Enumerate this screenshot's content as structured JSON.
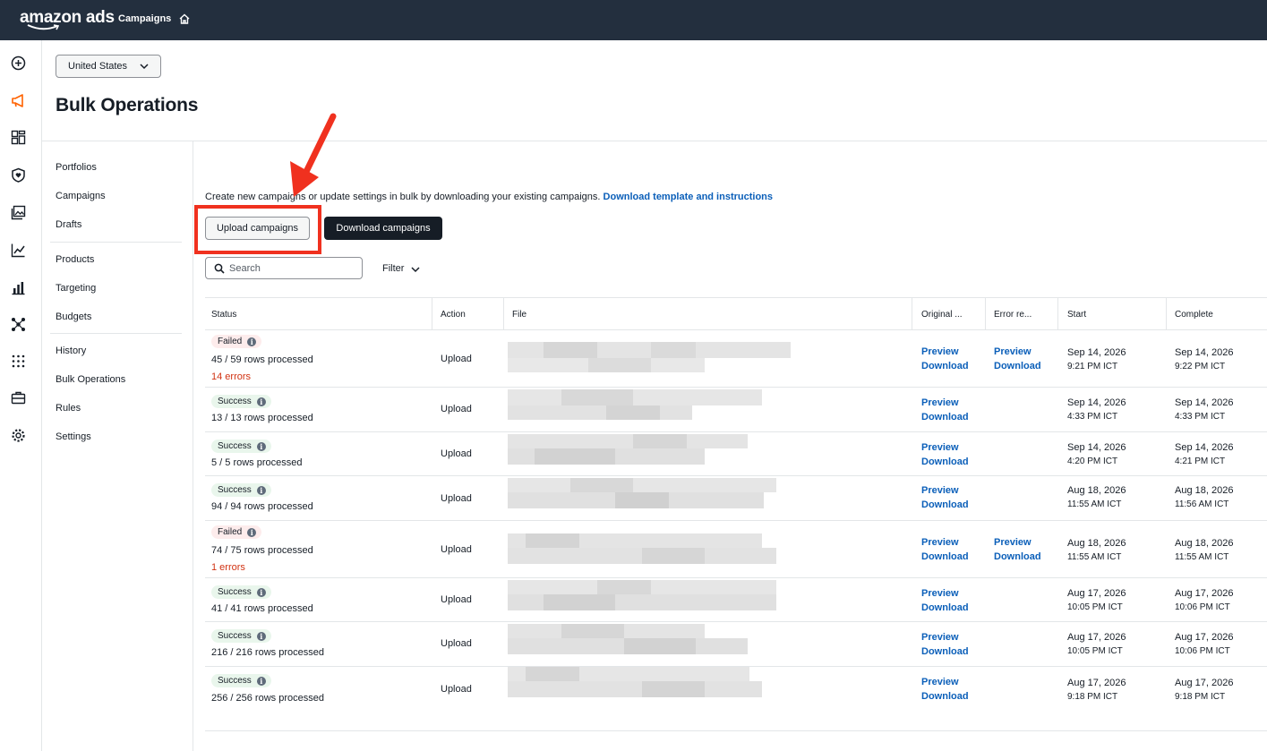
{
  "topbar": {
    "logo": "amazon ads",
    "nav_campaigns": "Campaigns"
  },
  "country_select": {
    "value": "United States"
  },
  "page_title": "Bulk Operations",
  "subnav": {
    "group1": [
      "Portfolios",
      "Campaigns",
      "Drafts"
    ],
    "group2": [
      "Products",
      "Targeting",
      "Budgets"
    ],
    "group3": [
      "History",
      "Bulk Operations",
      "Rules",
      "Settings"
    ]
  },
  "intro": {
    "text": "Create new campaigns or update settings in bulk by downloading your existing campaigns.",
    "link": "Download template and instructions"
  },
  "buttons": {
    "upload": "Upload campaigns",
    "download": "Download campaigns"
  },
  "search": {
    "placeholder": "Search"
  },
  "filter": {
    "label": "Filter"
  },
  "table": {
    "headers": [
      "Status",
      "Action",
      "File",
      "Original ...",
      "Error re...",
      "Start",
      "Complete"
    ],
    "rows": [
      {
        "status": "Failed",
        "rows": "45 / 59 rows processed",
        "errors": "14 errors",
        "action": "Upload",
        "orig_preview": "Preview",
        "orig_download": "Download",
        "err_preview": "Preview",
        "err_download": "Download",
        "start_date": "Sep 14, 2026",
        "start_time": "9:21 PM ICT",
        "complete_date": "Sep 14, 2026",
        "complete_time": "9:22 PM ICT"
      },
      {
        "status": "Success",
        "rows": "13 / 13 rows processed",
        "errors": "",
        "action": "Upload",
        "orig_preview": "Preview",
        "orig_download": "Download",
        "err_preview": "",
        "err_download": "",
        "start_date": "Sep 14, 2026",
        "start_time": "4:33 PM ICT",
        "complete_date": "Sep 14, 2026",
        "complete_time": "4:33 PM ICT"
      },
      {
        "status": "Success",
        "rows": "5 / 5 rows processed",
        "errors": "",
        "action": "Upload",
        "orig_preview": "Preview",
        "orig_download": "Download",
        "err_preview": "",
        "err_download": "",
        "start_date": "Sep 14, 2026",
        "start_time": "4:20 PM ICT",
        "complete_date": "Sep 14, 2026",
        "complete_time": "4:21 PM ICT"
      },
      {
        "status": "Success",
        "rows": "94 / 94 rows processed",
        "errors": "",
        "action": "Upload",
        "orig_preview": "Preview",
        "orig_download": "Download",
        "err_preview": "",
        "err_download": "",
        "start_date": "Aug 18, 2026",
        "start_time": "11:55 AM ICT",
        "complete_date": "Aug 18, 2026",
        "complete_time": "11:56 AM ICT"
      },
      {
        "status": "Failed",
        "rows": "74 / 75 rows processed",
        "errors": "1 errors",
        "action": "Upload",
        "orig_preview": "Preview",
        "orig_download": "Download",
        "err_preview": "Preview",
        "err_download": "Download",
        "start_date": "Aug 18, 2026",
        "start_time": "11:55 AM ICT",
        "complete_date": "Aug 18, 2026",
        "complete_time": "11:55 AM ICT"
      },
      {
        "status": "Success",
        "rows": "41 / 41 rows processed",
        "errors": "",
        "action": "Upload",
        "orig_preview": "Preview",
        "orig_download": "Download",
        "err_preview": "",
        "err_download": "",
        "start_date": "Aug 17, 2026",
        "start_time": "10:05 PM ICT",
        "complete_date": "Aug 17, 2026",
        "complete_time": "10:06 PM ICT"
      },
      {
        "status": "Success",
        "rows": "216 / 216 rows processed",
        "errors": "",
        "action": "Upload",
        "orig_preview": "Preview",
        "orig_download": "Download",
        "err_preview": "",
        "err_download": "",
        "start_date": "Aug 17, 2026",
        "start_time": "10:05 PM ICT",
        "complete_date": "Aug 17, 2026",
        "complete_time": "10:06 PM ICT"
      },
      {
        "status": "Success",
        "rows": "256 / 256 rows processed",
        "errors": "",
        "action": "Upload",
        "orig_preview": "Preview",
        "orig_download": "Download",
        "err_preview": "",
        "err_download": "",
        "start_date": "Aug 17, 2026",
        "start_time": "9:18 PM ICT",
        "complete_date": "Aug 17, 2026",
        "complete_time": "9:18 PM ICT"
      }
    ]
  },
  "colors": {
    "topbar": "#232f3e",
    "link": "#0b5fb9",
    "error": "#d13212",
    "highlight": "#f0311f",
    "active_rail": "#ff6200"
  },
  "icons": [
    "plus-circle-icon",
    "megaphone-icon",
    "dashboard-icon",
    "shield-heart-icon",
    "images-icon",
    "trend-icon",
    "bar-chart-icon",
    "network-icon",
    "grid-dots-icon",
    "briefcase-icon",
    "gear-icon"
  ]
}
